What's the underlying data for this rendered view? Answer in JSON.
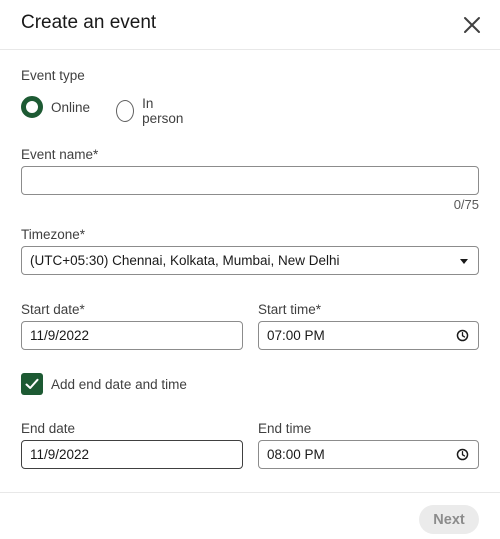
{
  "header": {
    "title": "Create an event",
    "close_icon": "close-icon"
  },
  "event_type": {
    "label": "Event type",
    "options": [
      {
        "label": "Online",
        "selected": true
      },
      {
        "label": "In person",
        "selected": false
      }
    ]
  },
  "event_name": {
    "label": "Event name*",
    "value": "",
    "placeholder": "",
    "counter": "0/75"
  },
  "timezone": {
    "label": "Timezone*",
    "selected": "(UTC+05:30) Chennai, Kolkata, Mumbai, New Delhi",
    "icon": "caret-down-icon"
  },
  "start_date": {
    "label": "Start date*",
    "value": "11/9/2022"
  },
  "start_time": {
    "label": "Start time*",
    "value": "07:00 PM",
    "icon": "clock-icon"
  },
  "end_toggle": {
    "label": "Add end date and time",
    "checked": true
  },
  "end_date": {
    "label": "End date",
    "value": "11/9/2022"
  },
  "end_time": {
    "label": "End time",
    "value": "08:00 PM",
    "icon": "clock-icon"
  },
  "footer": {
    "next_label": "Next",
    "next_disabled": true
  },
  "colors": {
    "accent": "#1d5a33",
    "disabled_bg": "#ebebeb",
    "disabled_text": "#8c8c8c"
  }
}
